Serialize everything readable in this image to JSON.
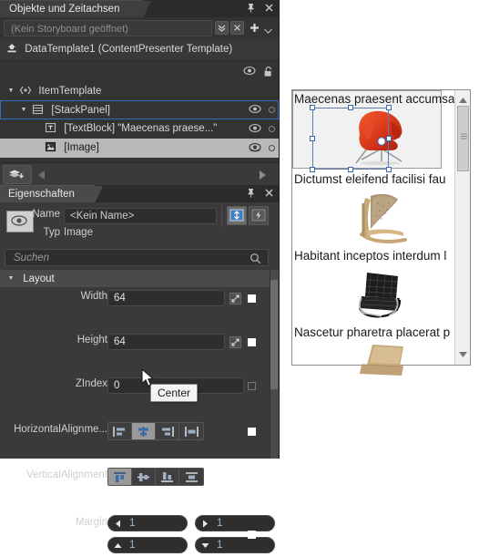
{
  "objects_panel": {
    "tab_label": "Objekte und Zeitachsen",
    "storyboard_placeholder": "(Kein Storyboard geöffnet)",
    "root_item": "DataTemplate1 (ContentPresenter Template)",
    "tree": [
      {
        "label": "ItemTemplate",
        "icon": "template-icon",
        "indent": 1,
        "twisty": "▼",
        "state": "normal"
      },
      {
        "label": "[StackPanel]",
        "icon": "stackpanel-icon",
        "indent": 2,
        "twisty": "▼",
        "state": "selected-outline"
      },
      {
        "label": "[TextBlock] \"Maecenas praese...\"",
        "icon": "textblock-icon",
        "indent": 3,
        "twisty": "",
        "state": "normal"
      },
      {
        "label": "[Image]",
        "icon": "image-icon",
        "indent": 3,
        "twisty": "",
        "state": "selected"
      }
    ]
  },
  "properties_panel": {
    "tab_label": "Eigenschaften",
    "name_label": "Name",
    "name_value": "<Kein Name>",
    "type_label": "Typ",
    "type_value": "Image",
    "search_placeholder": "Suchen",
    "section_layout": "Layout",
    "rows": {
      "width_label": "Width",
      "width_value": "64",
      "height_label": "Height",
      "height_value": "64",
      "zindex_label": "ZIndex",
      "zindex_value": "0",
      "halign_label": "HorizontalAlignme...",
      "valign_label": "VerticalAlignment",
      "margin_label": "Margin",
      "margin_left": "1",
      "margin_right": "1",
      "margin_top": "1",
      "margin_bottom": "1"
    },
    "halign_options": [
      "Left",
      "Center",
      "Right",
      "Stretch"
    ],
    "halign_selected": "Center",
    "valign_options": [
      "Top",
      "Center",
      "Bottom",
      "Stretch"
    ],
    "valign_selected": "Top"
  },
  "tooltip": {
    "text": "Center"
  },
  "preview": {
    "items": [
      {
        "text": "Maecenas praesent accumsa",
        "chair": "red-swan-chair",
        "selected": true
      },
      {
        "text": "Dictumst eleifend facilisi fau",
        "chair": "wood-lounge-chair",
        "selected": false
      },
      {
        "text": "Habitant inceptos interdum l",
        "chair": "black-barcelona-chair",
        "selected": false
      },
      {
        "text": "Nascetur pharetra placerat p",
        "chair": "tan-plywood-chair",
        "selected": false
      }
    ]
  },
  "colors": {
    "panel_bg": "#3a3a3a",
    "tree_bg": "#333333",
    "accent_selection": "#2f6fbb",
    "selected_row": "#b8b8b8",
    "text": "#d6d6d6",
    "preview_bg": "#ffffff"
  }
}
